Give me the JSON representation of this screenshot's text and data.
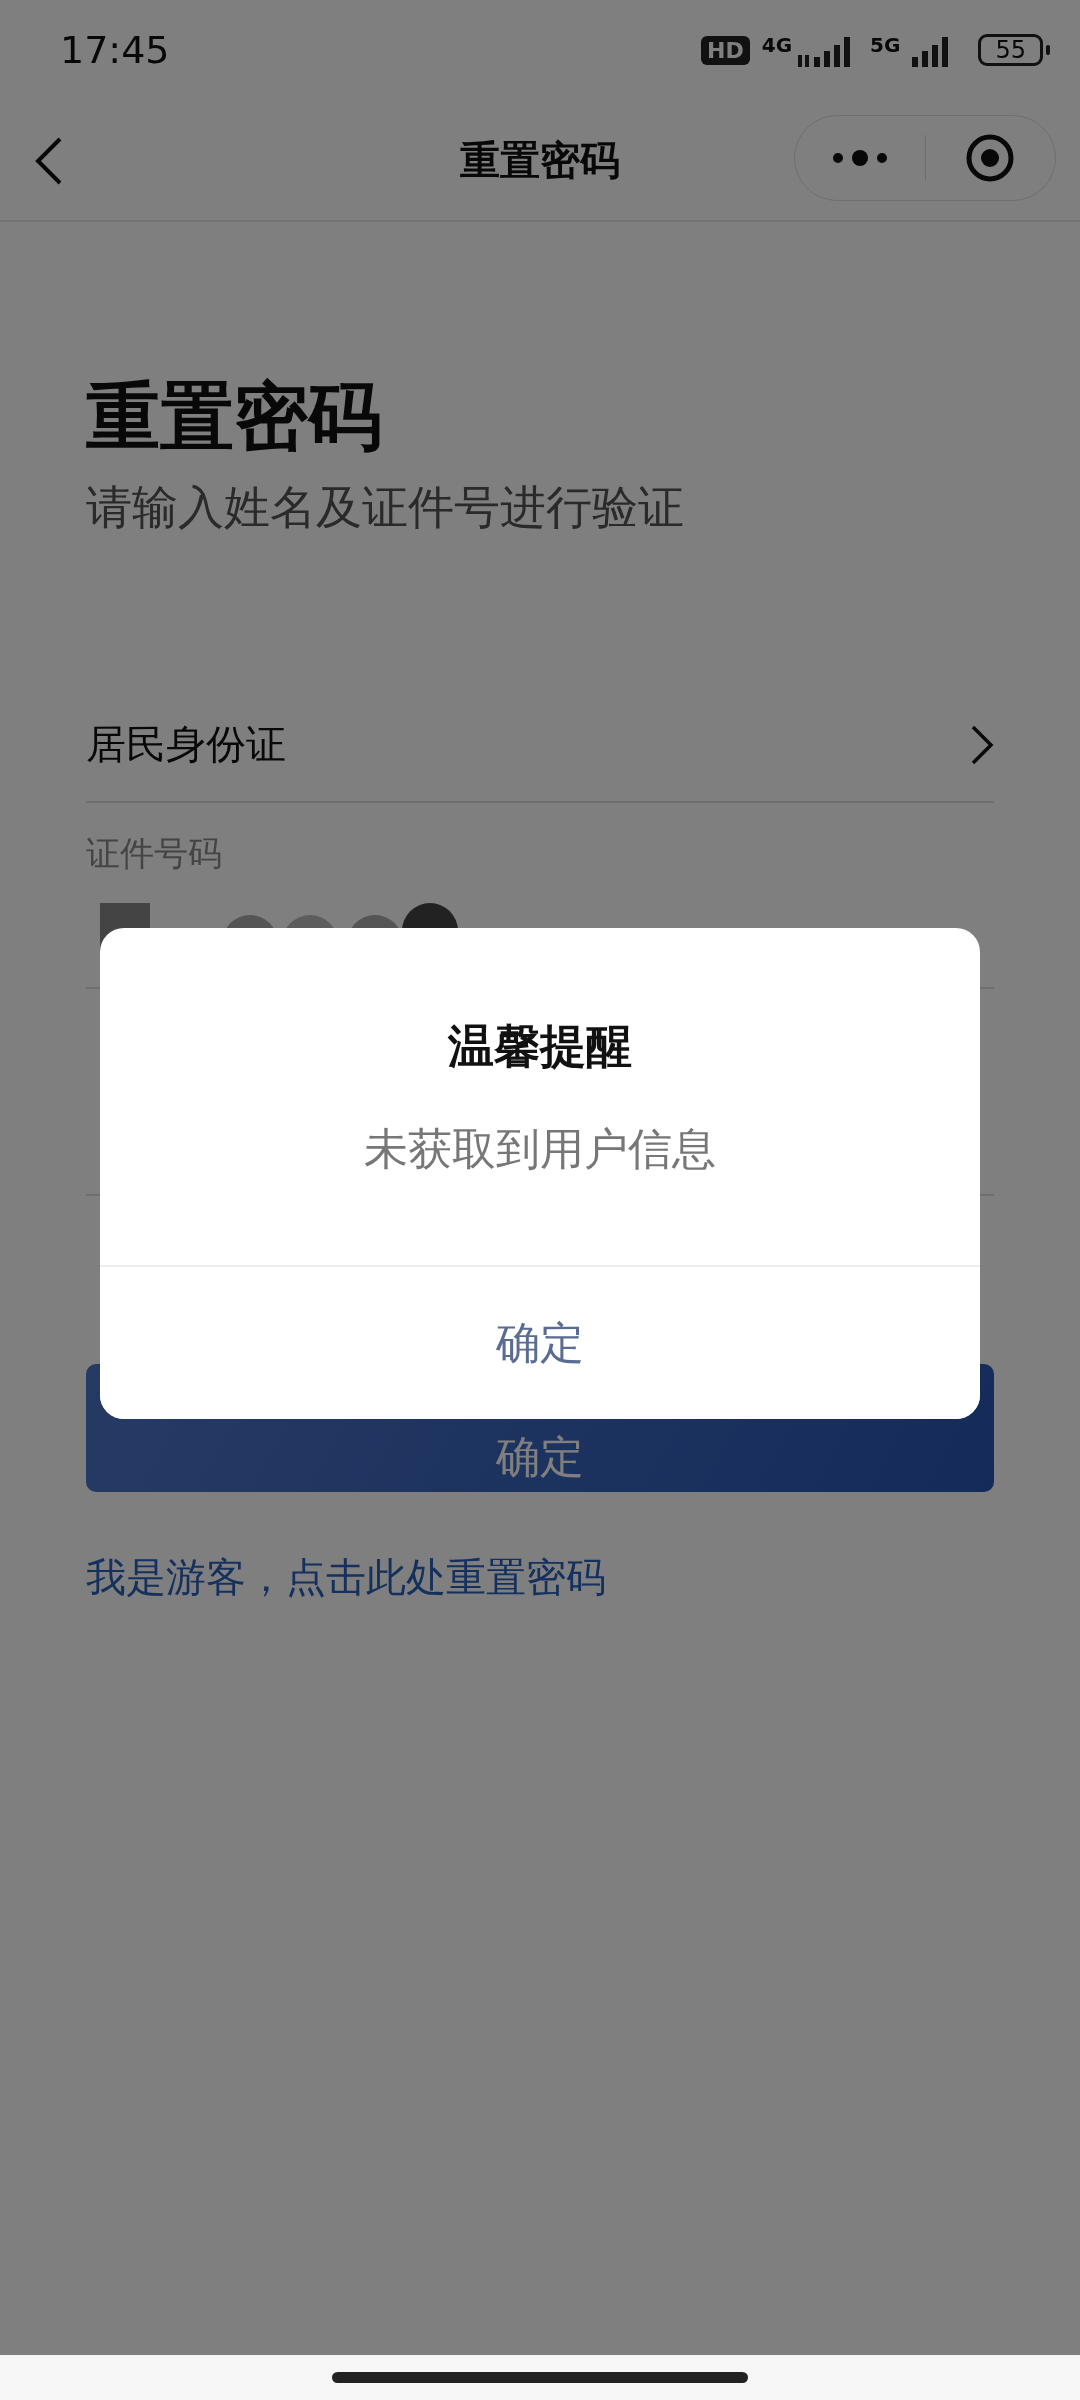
{
  "status_bar": {
    "time": "17:45",
    "hd_badge": "HD",
    "network_1": "4G",
    "network_2": "5G",
    "battery": "55"
  },
  "nav_bar": {
    "title": "重置密码"
  },
  "heading": {
    "title": "重置密码",
    "subtitle": "请输入姓名及证件号进行验证"
  },
  "form": {
    "id_type": "居民身份证",
    "id_label": "证件号码",
    "submit": "确定"
  },
  "guest_link": "我是游客，点击此处重置密码",
  "dialog": {
    "title": "温馨提醒",
    "message": "未获取到用户信息",
    "button": "确定"
  }
}
